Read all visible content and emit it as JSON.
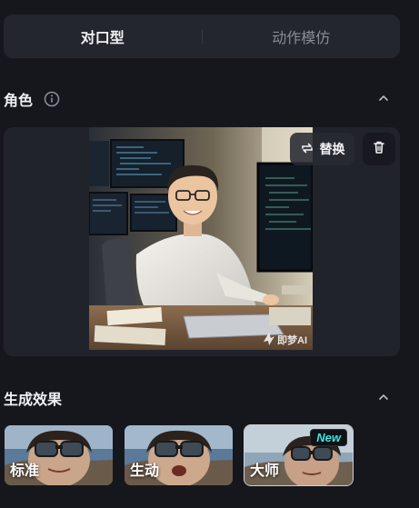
{
  "tabs": [
    {
      "label": "对口型",
      "active": true
    },
    {
      "label": "动作模仿",
      "active": false
    }
  ],
  "role_section": {
    "title": "角色",
    "replace_label": "替换",
    "watermark": "即梦AI"
  },
  "effects_section": {
    "title": "生成效果",
    "items": [
      {
        "label": "标准",
        "selected": false
      },
      {
        "label": "生动",
        "selected": false
      },
      {
        "label": "大师",
        "selected": true,
        "badge": "New"
      }
    ]
  },
  "icons": {
    "info": "info-icon",
    "collapse": "chevron-up-icon",
    "replace": "swap-icon",
    "delete": "trash-icon"
  },
  "colors": {
    "background": "#16171d",
    "card": "#21232b",
    "badge_text": "#3ee6e0"
  }
}
